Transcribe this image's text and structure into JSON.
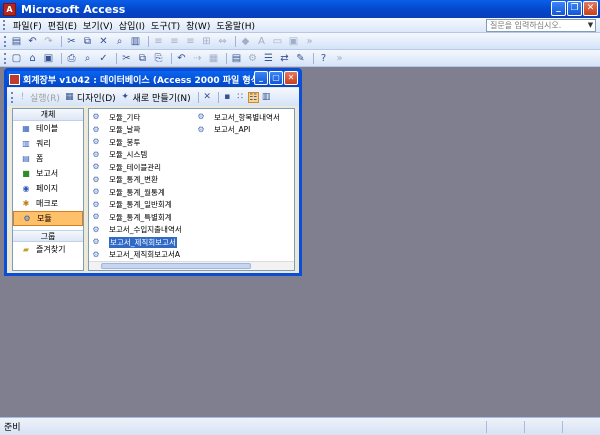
{
  "app": {
    "title": "Microsoft Access",
    "icon_name": "access-app-icon"
  },
  "menubar": {
    "items": [
      "파일(F)",
      "편집(E)",
      "보기(V)",
      "삽입(I)",
      "도구(T)",
      "창(W)",
      "도움말(H)"
    ],
    "help_placeholder": "질문을 입력하십시오."
  },
  "dbwindow": {
    "title": "회계장부 v1042 : 데이터베이스 (Access 2000 파일 형식)",
    "toolbar": {
      "open_label": "실행(R)",
      "design_label": "디자인(D)",
      "new_label": "새로 만들기(N)"
    },
    "objects_header": "개체",
    "objects": [
      {
        "label": "테이블",
        "icon": "table-icon"
      },
      {
        "label": "쿼리",
        "icon": "query-icon"
      },
      {
        "label": "폼",
        "icon": "form-icon"
      },
      {
        "label": "보고서",
        "icon": "report-icon"
      },
      {
        "label": "페이지",
        "icon": "page-icon"
      },
      {
        "label": "매크로",
        "icon": "macro-icon"
      },
      {
        "label": "모듈",
        "icon": "module-icon"
      }
    ],
    "selected_object": "모듈",
    "groups_header": "그룹",
    "groups": [
      {
        "label": "즐겨찾기",
        "icon": "favorites-folder-icon"
      }
    ],
    "list_col1": [
      "모듈_기타",
      "모듈_날짜",
      "모듈_봉투",
      "모듈_시스템",
      "모듈_테이블관리",
      "모듈_통계_변환",
      "모듈_통계_월통계",
      "모듈_통계_일반회계",
      "모듈_통계_특별회계",
      "보고서_수입지출내역서",
      "보고서_제직회보고서",
      "보고서_제직회보고서A"
    ],
    "list_col2": [
      "보고서_항목별내역서",
      "보고서_API"
    ],
    "selected_item": "보고서_제직회보고서"
  },
  "statusbar": {
    "text": "준비"
  }
}
